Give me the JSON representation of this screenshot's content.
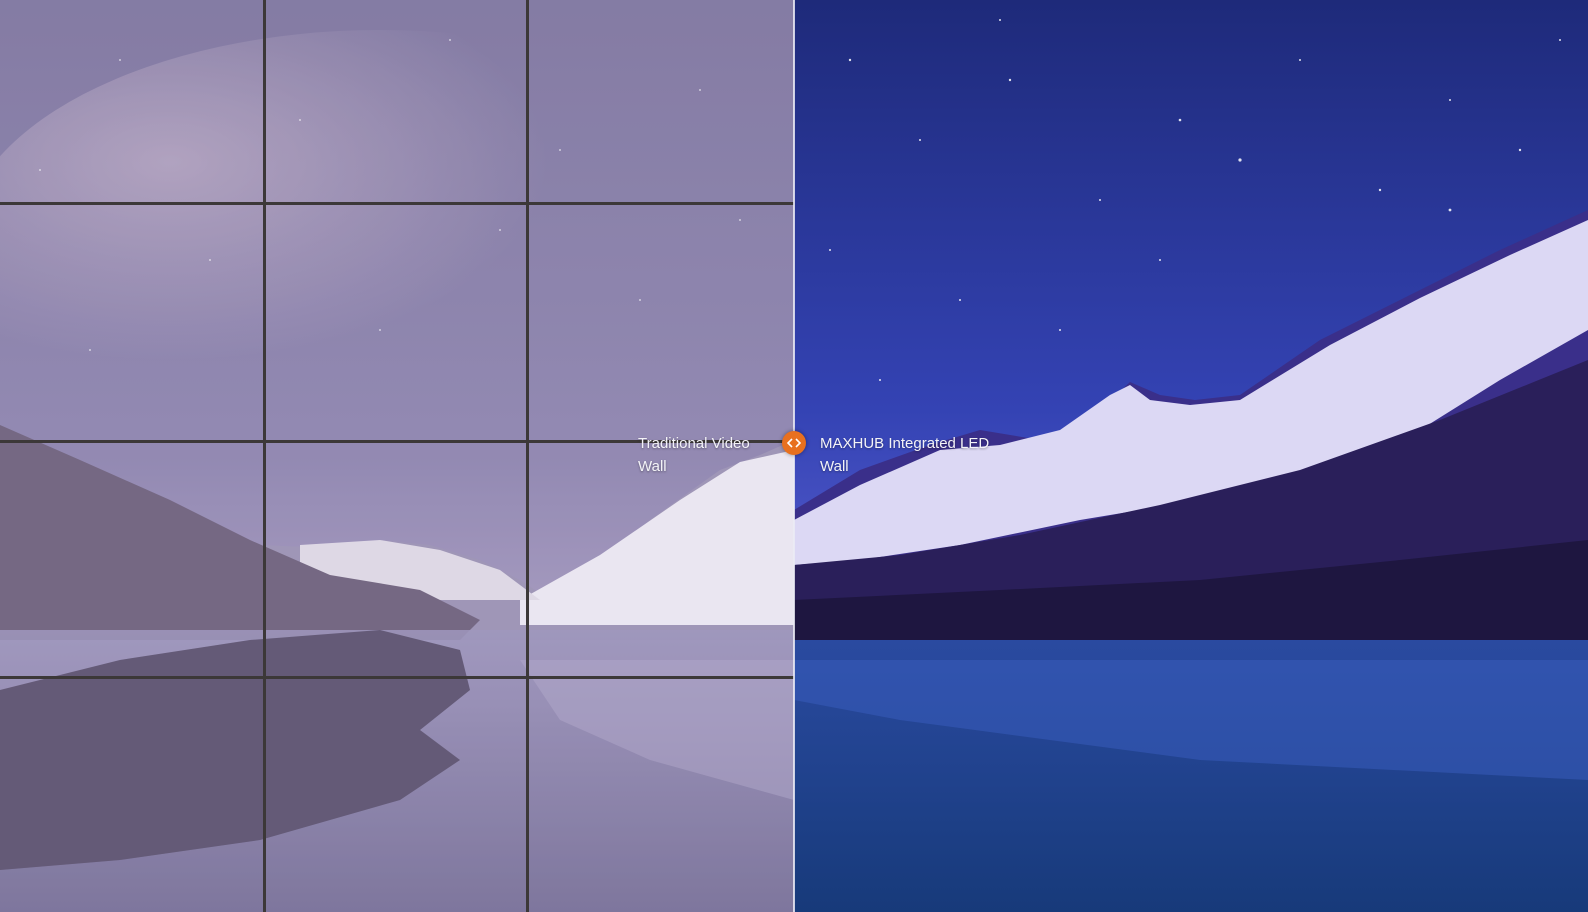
{
  "comparison": {
    "left_label": "Traditional Video Wall",
    "right_label": "MAXHUB Integrated LED Wall",
    "handle_icon": "left-right-arrows-icon",
    "accent_color": "#e8701f",
    "left_tint": "#8c78a0",
    "right_tint": "#2f3fb0"
  }
}
